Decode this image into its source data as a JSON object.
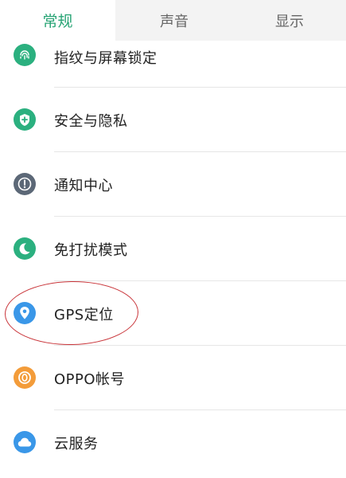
{
  "tabs": [
    {
      "label": "常规",
      "active": true
    },
    {
      "label": "声音",
      "active": false
    },
    {
      "label": "显示",
      "active": false
    }
  ],
  "items": [
    {
      "label": "指纹与屏幕锁定",
      "icon": "fingerprint-icon",
      "color": "#2bb07f"
    },
    {
      "label": "安全与隐私",
      "icon": "shield-icon",
      "color": "#2bb07f"
    },
    {
      "label": "通知中心",
      "icon": "notification-icon",
      "color": "#5c6877"
    },
    {
      "label": "免打扰模式",
      "icon": "moon-icon",
      "color": "#2bb07f"
    },
    {
      "label": "GPS定位",
      "icon": "location-icon",
      "color": "#3a97e8"
    },
    {
      "label": "OPPO帐号",
      "icon": "account-icon",
      "color": "#f39c3a"
    },
    {
      "label": "云服务",
      "icon": "cloud-icon",
      "color": "#3a97e8"
    }
  ],
  "colors": {
    "accent": "#28a475",
    "highlight_ring": "#c9353a"
  }
}
